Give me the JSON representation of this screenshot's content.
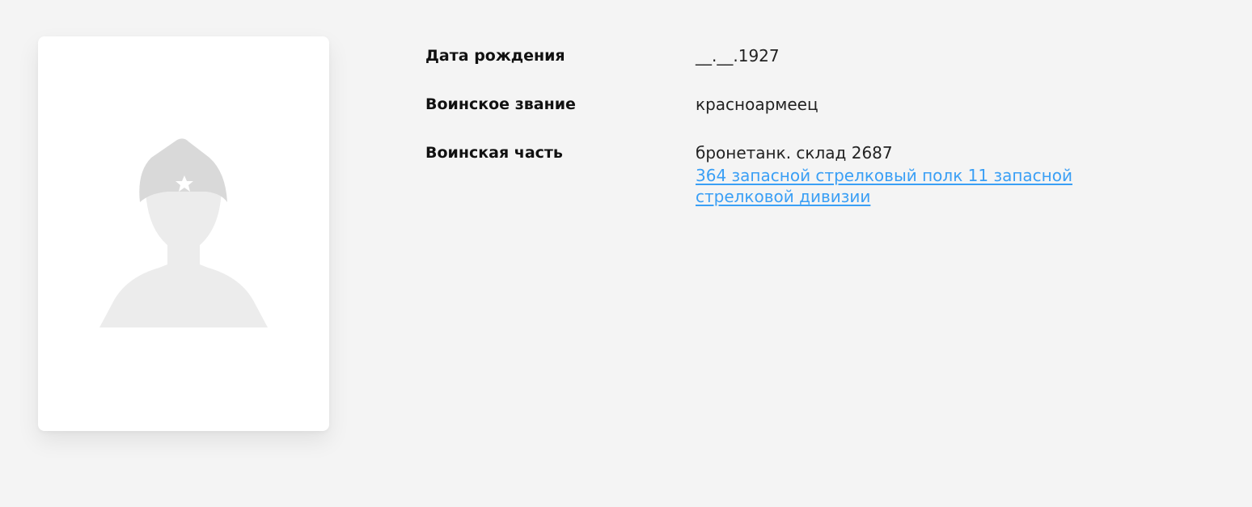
{
  "profile": {
    "photo_icon": "soldier-placeholder-icon",
    "fields": {
      "birth_date": {
        "label": "Дата рождения",
        "value": "__.__.1927"
      },
      "rank": {
        "label": "Воинское звание",
        "value": "красноармеец"
      },
      "unit": {
        "label": "Воинская часть",
        "value": "бронетанк. склад 2687",
        "link_text": "364 запасной стрелковый полк 11 запасной стрелковой дивизии"
      }
    }
  },
  "colors": {
    "background": "#f4f4f4",
    "card": "#ffffff",
    "silhouette": "#ececec",
    "cap": "#d9d9d9",
    "link": "#3a9ff5"
  }
}
